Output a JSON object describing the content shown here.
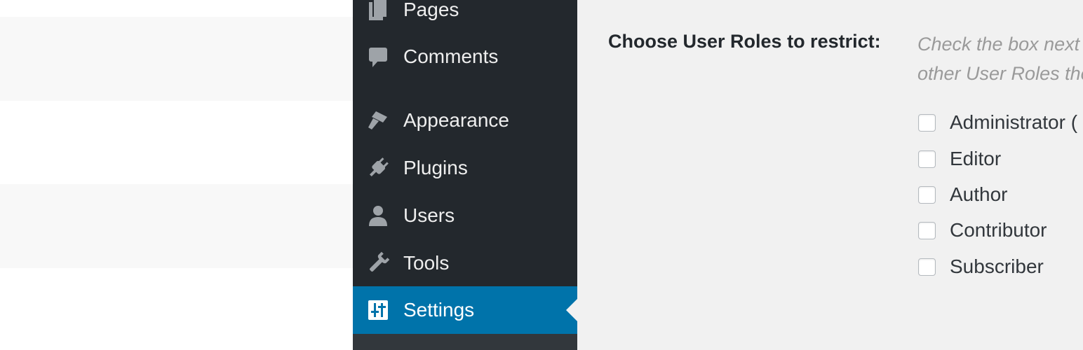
{
  "sidebar": {
    "items": [
      {
        "label": "Pages",
        "icon": "pages-icon"
      },
      {
        "label": "Comments",
        "icon": "comments-icon"
      },
      {
        "label": "Appearance",
        "icon": "appearance-icon"
      },
      {
        "label": "Plugins",
        "icon": "plugins-icon"
      },
      {
        "label": "Users",
        "icon": "users-icon"
      },
      {
        "label": "Tools",
        "icon": "tools-icon"
      },
      {
        "label": "Settings",
        "icon": "settings-icon",
        "active": true
      }
    ],
    "colors": {
      "background": "#23282d",
      "active": "#0073aa",
      "icon": "#9ea3a8"
    }
  },
  "form": {
    "label": "Choose User Roles to restrict:",
    "description_line1": "Check the box next",
    "description_line2": "other User Roles the",
    "roles": [
      {
        "label": "Administrator (",
        "checked": false
      },
      {
        "label": "Editor",
        "checked": false
      },
      {
        "label": "Author",
        "checked": false
      },
      {
        "label": "Contributor",
        "checked": false
      },
      {
        "label": "Subscriber",
        "checked": false
      }
    ]
  }
}
